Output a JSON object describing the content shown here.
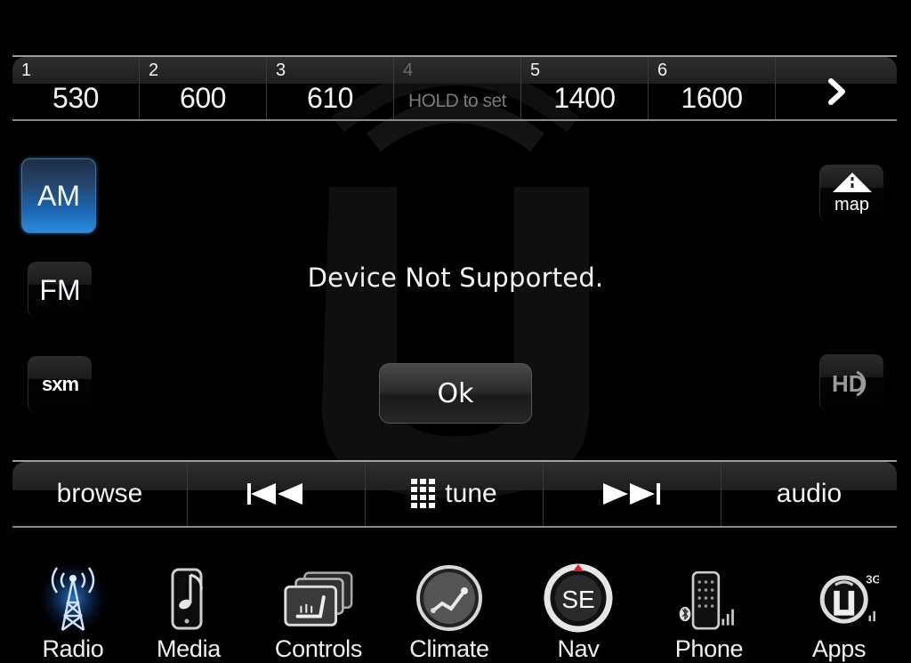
{
  "presets": [
    {
      "number": "1",
      "frequency": "530"
    },
    {
      "number": "2",
      "frequency": "600"
    },
    {
      "number": "3",
      "frequency": "610"
    },
    {
      "number": "4",
      "frequency": "HOLD to set",
      "empty": true
    },
    {
      "number": "5",
      "frequency": "1400"
    },
    {
      "number": "6",
      "frequency": "1600"
    }
  ],
  "preset_next_icon": "chevron-right-icon",
  "bands": {
    "am": "AM",
    "fm": "FM",
    "sxm": "sxm",
    "active": "AM"
  },
  "right_buttons": {
    "map": "map",
    "hd": "HD"
  },
  "dialog": {
    "message": "Device Not Supported.",
    "ok_label": "Ok"
  },
  "controls": {
    "browse": "browse",
    "prev_icon": "seek-back-icon",
    "tune": "tune",
    "next_icon": "seek-forward-icon",
    "audio": "audio"
  },
  "nav": [
    {
      "label": "Radio",
      "icon": "radio-tower-icon",
      "active": true
    },
    {
      "label": "Media",
      "icon": "media-phone-note-icon"
    },
    {
      "label": "Controls",
      "icon": "seat-controls-icon"
    },
    {
      "label": "Climate",
      "icon": "climate-icon"
    },
    {
      "label": "Nav",
      "icon": "compass-icon",
      "compass_heading": "SE"
    },
    {
      "label": "Phone",
      "icon": "phone-keypad-icon"
    },
    {
      "label": "Apps",
      "icon": "uconnect-apps-icon",
      "network": "3G"
    }
  ],
  "colors": {
    "accent_blue": "#1b66b3",
    "nav_red_marker": "#e0202a",
    "background": "#000000"
  }
}
